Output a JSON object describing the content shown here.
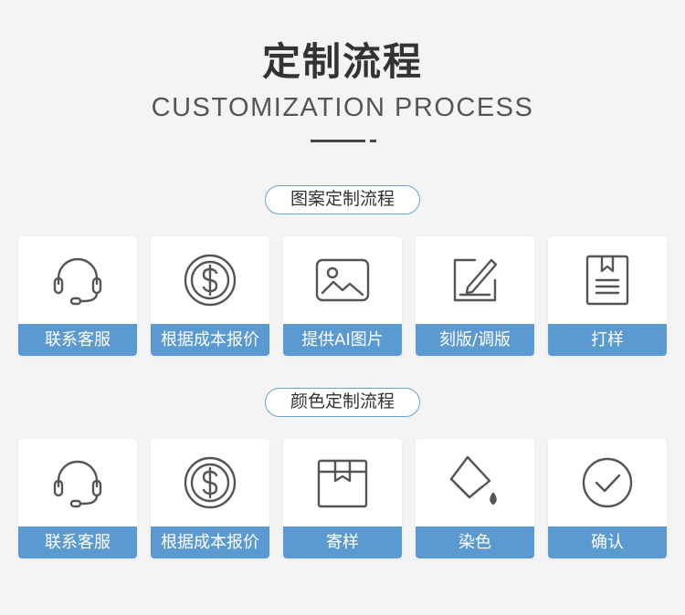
{
  "header": {
    "title": "定制流程",
    "subtitle": "CUSTOMIZATION PROCESS"
  },
  "colors": {
    "accent": "#5b9ad0",
    "pill_border": "#6ea3d0",
    "background": "#f4f4f4",
    "icon_stroke": "#555555"
  },
  "sections": [
    {
      "title": "图案定制流程",
      "steps": [
        {
          "label": "联系客服",
          "icon": "headset-icon"
        },
        {
          "label": "根据成本报价",
          "icon": "dollar-coin-icon"
        },
        {
          "label": "提供AI图片",
          "icon": "image-icon"
        },
        {
          "label": "刻版/调版",
          "icon": "edit-pen-icon"
        },
        {
          "label": "打样",
          "icon": "document-bookmark-icon"
        }
      ]
    },
    {
      "title": "颜色定制流程",
      "steps": [
        {
          "label": "联系客服",
          "icon": "headset-icon"
        },
        {
          "label": "根据成本报价",
          "icon": "dollar-coin-icon"
        },
        {
          "label": "寄样",
          "icon": "package-box-icon"
        },
        {
          "label": "染色",
          "icon": "paint-bucket-icon"
        },
        {
          "label": "确认",
          "icon": "check-circle-icon"
        }
      ]
    }
  ]
}
